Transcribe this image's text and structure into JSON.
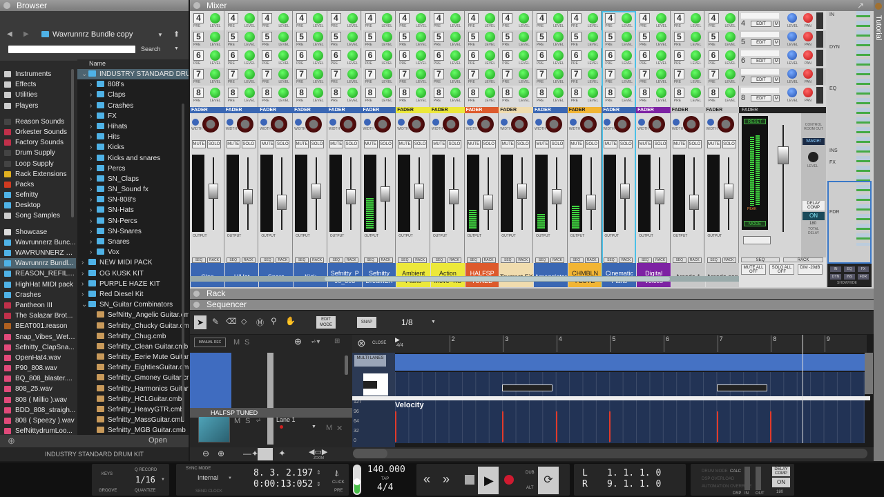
{
  "browser": {
    "title": "Browser",
    "location": "Wavrunnrz Bundle  copy",
    "search_label": "Search",
    "name_header": "Name",
    "open_label": "Open",
    "footer": "INDUSTRY STANDARD  DRUM KIT",
    "left_items": [
      {
        "label": "Instruments",
        "icon": "instruments-icon",
        "color": "#ccc"
      },
      {
        "label": "Effects",
        "icon": "effects-icon",
        "color": "#ccc"
      },
      {
        "label": "Utilities",
        "icon": "utilities-icon",
        "color": "#ccc"
      },
      {
        "label": "Players",
        "icon": "players-icon",
        "color": "#ccc"
      },
      {
        "label": "",
        "icon": "",
        "color": ""
      },
      {
        "label": "Reason Sounds",
        "icon": "refill-icon",
        "color": "#444"
      },
      {
        "label": "Orkester Sounds",
        "icon": "refill-icon",
        "color": "#c0304a"
      },
      {
        "label": "Factory Sounds",
        "icon": "refill-icon",
        "color": "#c0304a"
      },
      {
        "label": "Drum Supply",
        "icon": "refill-icon",
        "color": "#444"
      },
      {
        "label": "Loop Supply",
        "icon": "refill-icon",
        "color": "#444"
      },
      {
        "label": "Rack Extensions",
        "icon": "rack-extension-icon",
        "color": "#e0b020"
      },
      {
        "label": "Packs",
        "icon": "packs-icon",
        "color": "#d03a20"
      },
      {
        "label": "Sefnitty",
        "icon": "folder-icon",
        "color": "#4fb2e6"
      },
      {
        "label": "Desktop",
        "icon": "folder-icon",
        "color": "#4fb2e6"
      },
      {
        "label": "Song Samples",
        "icon": "song-samples-icon",
        "color": "#ccc"
      },
      {
        "label": "",
        "icon": "",
        "color": ""
      },
      {
        "label": "Showcase",
        "icon": "star-icon",
        "color": "#ddd"
      },
      {
        "label": "Wavrunnerz Bunc...",
        "icon": "folder-icon",
        "color": "#4fb2e6"
      },
      {
        "label": "WAVRUNNERZ D...",
        "icon": "folder-icon",
        "color": "#4fb2e6"
      },
      {
        "label": "Wavrunnrz Bundl...",
        "icon": "folder-icon",
        "color": "#4fb2e6",
        "selected": true
      },
      {
        "label": "REASON_REFILLS",
        "icon": "folder-icon",
        "color": "#4fb2e6"
      },
      {
        "label": "HighHat MIDI pack",
        "icon": "folder-icon",
        "color": "#4fb2e6"
      },
      {
        "label": "Crashes",
        "icon": "folder-icon",
        "color": "#4fb2e6"
      },
      {
        "label": "Pantheon III",
        "icon": "refill-icon",
        "color": "#c0304a"
      },
      {
        "label": "The Salazar Brot...",
        "icon": "refill-icon",
        "color": "#c0304a"
      },
      {
        "label": "BEAT001.reason",
        "icon": "reason-file-icon",
        "color": "#b06020"
      },
      {
        "label": "Snap_Vibes_Wet....",
        "icon": "audio-file-icon",
        "color": "#e04a7a"
      },
      {
        "label": "Sefnitty_ClapSna...",
        "icon": "audio-file-icon",
        "color": "#e04a7a"
      },
      {
        "label": "OpenHat4.wav",
        "icon": "audio-file-icon",
        "color": "#e04a7a"
      },
      {
        "label": "P90_808.wav",
        "icon": "audio-file-icon",
        "color": "#e04a7a"
      },
      {
        "label": "BQ_808_blaster....",
        "icon": "audio-file-icon",
        "color": "#e04a7a"
      },
      {
        "label": "808_25.wav",
        "icon": "audio-file-icon",
        "color": "#e04a7a"
      },
      {
        "label": "808 ( Millio ).wav",
        "icon": "audio-file-icon",
        "color": "#e04a7a"
      },
      {
        "label": "BDD_808_straigh...",
        "icon": "audio-file-icon",
        "color": "#e04a7a"
      },
      {
        "label": "808 ( Speezy ).wav",
        "icon": "audio-file-icon",
        "color": "#e04a7a"
      },
      {
        "label": "SefNittydrumLoo...",
        "icon": "audio-file-icon",
        "color": "#e04a7a"
      }
    ],
    "files": [
      {
        "label": "INDUSTRY STANDARD  DRU...",
        "depth": 0,
        "arrow": "⌄",
        "type": "folder",
        "selected": true
      },
      {
        "label": "808's",
        "depth": 1,
        "arrow": "›",
        "type": "folder"
      },
      {
        "label": "Claps",
        "depth": 1,
        "arrow": "›",
        "type": "folder"
      },
      {
        "label": "Crashes",
        "depth": 1,
        "arrow": "›",
        "type": "folder"
      },
      {
        "label": "FX",
        "depth": 1,
        "arrow": "›",
        "type": "folder"
      },
      {
        "label": "Hihats",
        "depth": 1,
        "arrow": "›",
        "type": "folder"
      },
      {
        "label": "Hits",
        "depth": 1,
        "arrow": "›",
        "type": "folder"
      },
      {
        "label": "Kicks",
        "depth": 1,
        "arrow": "›",
        "type": "folder"
      },
      {
        "label": "Kicks and snares",
        "depth": 1,
        "arrow": "›",
        "type": "folder"
      },
      {
        "label": "Percs",
        "depth": 1,
        "arrow": "›",
        "type": "folder"
      },
      {
        "label": "SN_Claps",
        "depth": 1,
        "arrow": "›",
        "type": "folder"
      },
      {
        "label": "SN_Sound fx",
        "depth": 1,
        "arrow": "›",
        "type": "folder"
      },
      {
        "label": "SN-808's",
        "depth": 1,
        "arrow": "›",
        "type": "folder"
      },
      {
        "label": "SN-Hats",
        "depth": 1,
        "arrow": "›",
        "type": "folder"
      },
      {
        "label": "SN-Percs",
        "depth": 1,
        "arrow": "›",
        "type": "folder"
      },
      {
        "label": "SN-Snares",
        "depth": 1,
        "arrow": "›",
        "type": "folder"
      },
      {
        "label": "Snares",
        "depth": 1,
        "arrow": "›",
        "type": "folder"
      },
      {
        "label": "Vox",
        "depth": 1,
        "arrow": "›",
        "type": "folder"
      },
      {
        "label": "NEW MIDI PACK",
        "depth": 0,
        "arrow": "›",
        "type": "folder"
      },
      {
        "label": "OG KUSK KIT",
        "depth": 0,
        "arrow": "›",
        "type": "folder"
      },
      {
        "label": "PURPLE HAZE KIT",
        "depth": 0,
        "arrow": "›",
        "type": "folder"
      },
      {
        "label": "Red Diesel Kit",
        "depth": 0,
        "arrow": "›",
        "type": "folder"
      },
      {
        "label": "SN_Guitar Combinators",
        "depth": 0,
        "arrow": "⌄",
        "type": "folder"
      },
      {
        "label": "SefNitty_Angelic Guitar.cmb",
        "depth": 1,
        "arrow": "",
        "type": "cmb"
      },
      {
        "label": "Sefnitty_Chucky Guitar.cmb",
        "depth": 1,
        "arrow": "",
        "type": "cmb"
      },
      {
        "label": "Sefnitty_Chug.cmb",
        "depth": 1,
        "arrow": "",
        "type": "cmb"
      },
      {
        "label": "Sefnitty_Clean Guitar.cmb",
        "depth": 1,
        "arrow": "",
        "type": "cmb"
      },
      {
        "label": "Sefnitty_Eerie Mute Guitar",
        "depth": 1,
        "arrow": "",
        "type": "cmb"
      },
      {
        "label": "Sefnitty_EightiesGuitar.cmb",
        "depth": 1,
        "arrow": "",
        "type": "cmb"
      },
      {
        "label": "Sefnitty_Gmoney Guitar.cmb",
        "depth": 1,
        "arrow": "",
        "type": "cmb"
      },
      {
        "label": "Sefnitty_Harmonics Guitar",
        "depth": 1,
        "arrow": "",
        "type": "cmb"
      },
      {
        "label": "Sefnitty_HCLGuitar.cmb",
        "depth": 1,
        "arrow": "",
        "type": "cmb"
      },
      {
        "label": "Sefnitty_HeavyGTR.cmb",
        "depth": 1,
        "arrow": "",
        "type": "cmb"
      },
      {
        "label": "Sefnitty_MassGuitar.cmb",
        "depth": 1,
        "arrow": "",
        "type": "cmb"
      },
      {
        "label": "Sefnitty_MGB Guitar.cmb",
        "depth": 1,
        "arrow": "",
        "type": "cmb"
      }
    ]
  },
  "mixer": {
    "title": "Mixer",
    "send_numbers": [
      "4",
      "5",
      "6",
      "7",
      "8"
    ],
    "pre_label": "PRE",
    "level_label": "LEVEL",
    "fader_label": "FADER",
    "width_label": "WIDTH",
    "mute_label": "MUTE",
    "solo_label": "SOLO",
    "output_label": "OUTPUT",
    "seq_label": "SEQ",
    "rack_label": "RACK",
    "channels": [
      {
        "name": "Clap",
        "color": "#3a67b3",
        "text": "#fff",
        "meter": 0
      },
      {
        "name": "HiHat",
        "color": "#3a67b3",
        "text": "#fff",
        "meter": 0
      },
      {
        "name": "Snare",
        "color": "#3a67b3",
        "text": "#fff",
        "meter": 0
      },
      {
        "name": "Kick",
        "color": "#3a67b3",
        "text": "#fff",
        "meter": 0
      },
      {
        "name": "Sefnitty_P 90_808",
        "color": "#3a67b3",
        "text": "#fff",
        "meter": 0
      },
      {
        "name": "Sefnitty DreamEX",
        "color": "#3a67b3",
        "text": "#fff",
        "meter": 0.4
      },
      {
        "name": "Ambient Piano",
        "color": "#ece83a",
        "text": "#222",
        "meter": 0
      },
      {
        "name": "Action Move -KS",
        "color": "#ece83a",
        "text": "#222",
        "meter": 0
      },
      {
        "name": "HALFSP TUNED",
        "color": "#dd5a2c",
        "text": "#fff",
        "meter": 0.25
      },
      {
        "name": "Trumpet EX",
        "color": "#f0dcae",
        "text": "#222",
        "meter": 0
      },
      {
        "name": "Arpeggiator",
        "color": "#3a67b3",
        "text": "#fff",
        "meter": 0.2
      },
      {
        "name": "CHMBLN FLUTE",
        "color": "#f2b534",
        "text": "#222",
        "meter": 0.3
      },
      {
        "name": "Cinematic Piano",
        "color": "#3a67b3",
        "text": "#fff",
        "meter": 0
      },
      {
        "name": "Digital Voices",
        "color": "#7d22a3",
        "text": "#fff",
        "meter": 0
      },
      {
        "name": "Arcade 1",
        "color": "#c8c8c8",
        "text": "#222",
        "meter": 0
      },
      {
        "name": "Arcade cop",
        "color": "#c8c8c8",
        "text": "#222",
        "meter": 0
      }
    ],
    "master": {
      "edit_label": "EDIT",
      "m_label": "M",
      "level_label": "LEVEL",
      "pan_label": "PAN",
      "reset_label": "RESET",
      "peak_label": "PEAK",
      "mode_label": "MODE",
      "control_room_label": "CONTROL ROOM OUT",
      "master_label": "Master",
      "delay_comp_label": "DELAY COMP",
      "on_label": "ON",
      "total_delay_value": "180",
      "total_delay_label": "TOTAL DELAY",
      "mute_all_label": "MUTE ALL OFF",
      "solo_all_label": "SOLO ALL OFF",
      "dim_label": "DIM -20dB"
    },
    "rack_sections": [
      "IN",
      "DYN",
      "EQ",
      "INS",
      "FX",
      "FDR"
    ],
    "showhide_buttons": [
      "IN",
      "EQ",
      "FX",
      "DYN",
      "INS",
      "FDR"
    ],
    "showhide_label": "SHOW/HIDE"
  },
  "tutorial_label": "Tutorial",
  "rack": {
    "title": "Rack"
  },
  "sequencer": {
    "title": "Sequencer",
    "edit_mode": "EDIT MODE",
    "snap": "SNAP",
    "snap_value": "1/8",
    "manual_rec": "MANUAL REC",
    "m": "M",
    "s": "S",
    "close": "CLOSE",
    "multi_lanes": "MULTI LANES",
    "time_sig": "4/4",
    "bars": [
      "2",
      "3",
      "4",
      "5",
      "6",
      "7",
      "8",
      "9"
    ],
    "track_name": "HALFSP TUNED",
    "lane_name": "Lane 1",
    "velocity_label": "Velocity",
    "velocity_ticks": [
      "127",
      "96",
      "64",
      "32",
      "0"
    ],
    "zoom_label": "ZOOM",
    "notes": [
      {
        "start": 3,
        "end": 3.94
      },
      {
        "start": 7,
        "end": 7.94
      }
    ],
    "velocity_events": [
      {
        "bar": 1,
        "value": 96
      },
      {
        "bar": 3,
        "value": 96
      },
      {
        "bar": 4,
        "value": 96
      },
      {
        "bar": 5,
        "value": 96
      },
      {
        "bar": 7,
        "value": 96
      },
      {
        "bar": 8,
        "value": 96
      }
    ],
    "playhead_bar": 8.6
  },
  "transport": {
    "keys": "KEYS",
    "groove": "GROOVE",
    "q_record": "Q RECORD",
    "quantize_value": "1/16",
    "quantize": "QUANTIZE",
    "sync_mode": "SYNC MODE",
    "sync_value": "Internal",
    "send_clock": "SEND CLOCK",
    "position": "8. 3. 2.197",
    "time": "0:00:13:052",
    "click": "CLICK",
    "pre": "PRE",
    "tempo": "140.000",
    "tap": "TAP",
    "signature": "4/4",
    "dub": "DUB",
    "alt": "ALT",
    "loop_left_label": "L",
    "loop_right_label": "R",
    "loop_left": "1. 1. 1.   0",
    "loop_right": "9. 1. 1.   0",
    "calc": "CALC",
    "dsp": "DSP",
    "in": "IN",
    "out": "OUT",
    "delay_comp": "DELAY COMP",
    "on": "ON",
    "delay_value": "180",
    "status_lines": [
      "DRUM MODE",
      "DSP OVERLOAD",
      "AUTOMATION OVERRIDE"
    ]
  }
}
